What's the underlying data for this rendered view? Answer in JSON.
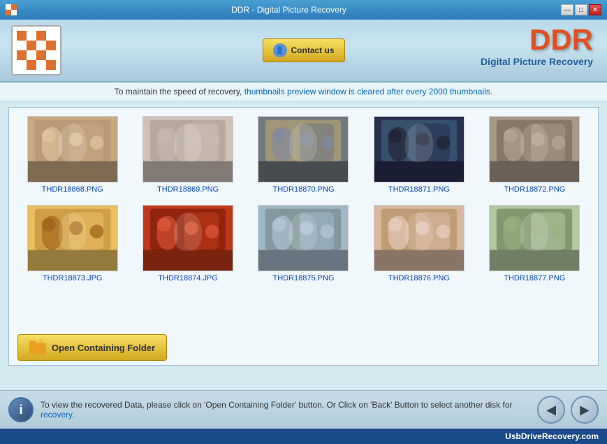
{
  "titleBar": {
    "title": "DDR - Digital Picture Recovery",
    "minBtn": "—",
    "maxBtn": "□",
    "closeBtn": "✕"
  },
  "header": {
    "contactBtn": "Contact us",
    "ddrTitle": "DDR",
    "ddrSubtitle": "Digital Picture Recovery"
  },
  "infoBar": {
    "text": "To maintain the speed of recovery, ",
    "highlight": "thumbnails preview window is cleared after every 2000 thumbnails.",
    "suffix": ""
  },
  "thumbnails": [
    {
      "label": "THDR18868.PNG",
      "class": "photo-1"
    },
    {
      "label": "THDR18869.PNG",
      "class": "photo-2"
    },
    {
      "label": "THDR18870.PNG",
      "class": "photo-3"
    },
    {
      "label": "THDR18871.PNG",
      "class": "photo-4"
    },
    {
      "label": "THDR18872.PNG",
      "class": "photo-5"
    },
    {
      "label": "THDR18873.JPG",
      "class": "photo-6"
    },
    {
      "label": "THDR18874.JPG",
      "class": "photo-7"
    },
    {
      "label": "THDR18875.PNG",
      "class": "photo-8"
    },
    {
      "label": "THDR18876.PNG",
      "class": "photo-9"
    },
    {
      "label": "THDR18877.PNG",
      "class": "photo-10"
    }
  ],
  "openFolderBtn": "Open Containing Folder",
  "statusText": {
    "normal": "To view the recovered Data, please click on 'Open Containing Folder' button. Or Click on 'Back' Button to select another disk for",
    "link": "recovery."
  },
  "footer": {
    "text": "UsbDriveRecovery.com"
  }
}
